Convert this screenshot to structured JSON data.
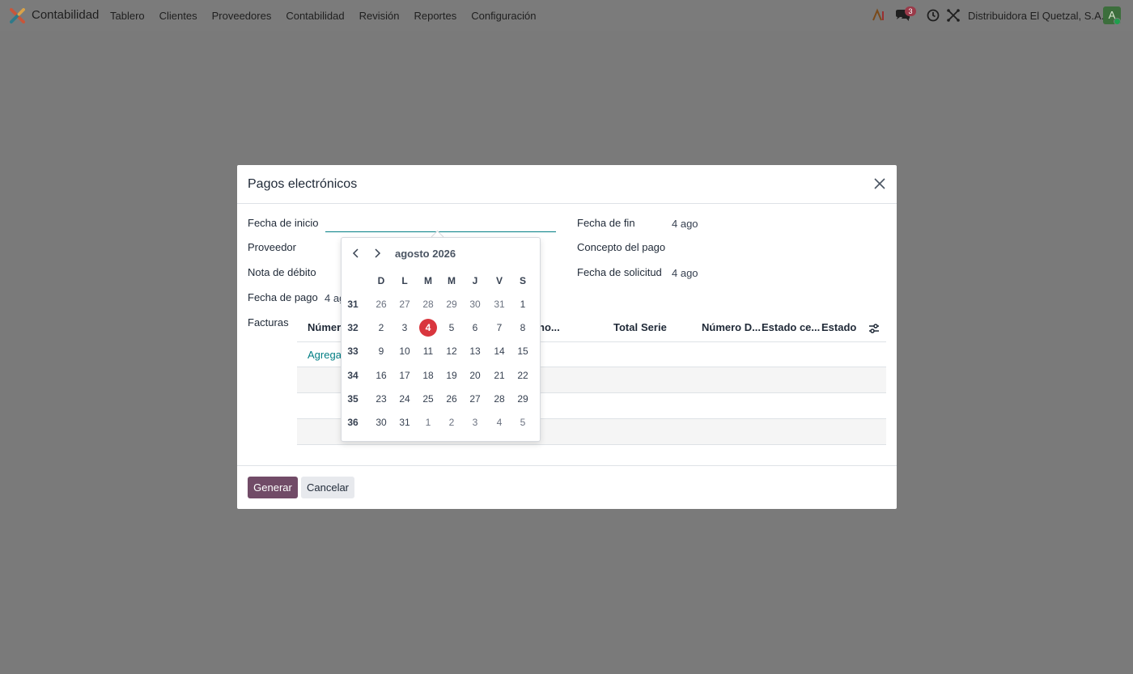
{
  "navbar": {
    "app_name": "Contabilidad",
    "menu": [
      "Tablero",
      "Clientes",
      "Proveedores",
      "Contabilidad",
      "Revisión",
      "Reportes",
      "Configuración"
    ],
    "messages_count": "3",
    "company": "Distribuidora El Quetzal, S.A.",
    "avatar_initial": "A"
  },
  "modal": {
    "title": "Pagos electrónicos",
    "left_fields": {
      "start_date_label": "Fecha de inicio",
      "supplier_label": "Proveedor",
      "debit_note_label": "Nota de débito",
      "payment_date_label": "Fecha de pago",
      "payment_date_value": "4 ago",
      "invoices_label": "Facturas"
    },
    "right_fields": {
      "end_date_label": "Fecha de fin",
      "end_date_value": "4 ago",
      "concept_label": "Concepto del pago",
      "request_date_label": "Fecha de solicitud",
      "request_date_value": "4 ago"
    },
    "table": {
      "columns": [
        "Número",
        "no...",
        "Total",
        "Serie",
        "Número D...",
        "Estado ce...",
        "Estado"
      ],
      "add_line": "Agregar"
    },
    "buttons": {
      "generate": "Generar",
      "cancel": "Cancelar"
    }
  },
  "datepicker": {
    "month_label": "agosto 2026",
    "weekdays": [
      "D",
      "L",
      "M",
      "M",
      "J",
      "V",
      "S"
    ],
    "weeks": [
      {
        "num": "31",
        "days": [
          "26",
          "27",
          "28",
          "29",
          "30",
          "31",
          "1"
        ]
      },
      {
        "num": "32",
        "days": [
          "2",
          "3",
          "4",
          "5",
          "6",
          "7",
          "8"
        ]
      },
      {
        "num": "33",
        "days": [
          "9",
          "10",
          "11",
          "12",
          "13",
          "14",
          "15"
        ]
      },
      {
        "num": "34",
        "days": [
          "16",
          "17",
          "18",
          "19",
          "20",
          "21",
          "22"
        ]
      },
      {
        "num": "35",
        "days": [
          "23",
          "24",
          "25",
          "26",
          "27",
          "28",
          "29"
        ]
      },
      {
        "num": "36",
        "days": [
          "30",
          "31",
          "1",
          "2",
          "3",
          "4",
          "5"
        ]
      }
    ],
    "today": "4",
    "accent_color": "#d9363e"
  },
  "colors": {
    "primary": "#714b67",
    "link": "#017e84"
  }
}
